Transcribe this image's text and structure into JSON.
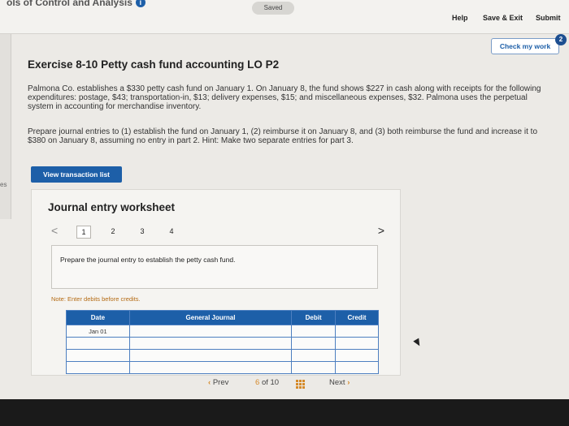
{
  "header": {
    "breadcrumb": "ols of Control and Analysis",
    "info_icon": "i",
    "status": "Saved",
    "help": "Help",
    "save_exit": "Save & Exit",
    "submit": "Submit",
    "check_work": "Check my work",
    "badge_count": "2"
  },
  "exercise": {
    "title": "Exercise 8-10 Petty cash fund accounting LO P2",
    "paragraph1": "Palmona Co. establishes a $330 petty cash fund on January 1. On January 8, the fund shows $227 in cash along with receipts for the following expenditures: postage, $43; transportation-in, $13; delivery expenses, $15; and miscellaneous expenses, $32. Palmona uses the perpetual system in accounting for merchandise inventory.",
    "paragraph2": "Prepare journal entries to (1) establish the fund on January 1, (2) reimburse it on January 8, and (3) both reimburse the fund and increase it to $380 on January 8, assuming no entry in part 2. Hint: Make two separate entries for part 3.",
    "view_transactions": "View transaction list",
    "edge_label": "es"
  },
  "worksheet": {
    "title": "Journal entry worksheet",
    "pages": [
      "1",
      "2",
      "3",
      "4"
    ],
    "active_page": "1",
    "prev_symbol": "<",
    "next_symbol": ">",
    "instruction": "Prepare the journal entry to establish the petty cash fund.",
    "note": "Note: Enter debits before credits.",
    "columns": [
      "Date",
      "General Journal",
      "Debit",
      "Credit"
    ],
    "rows": [
      {
        "date": "Jan 01",
        "account": "",
        "debit": "",
        "credit": ""
      },
      {
        "date": "",
        "account": "",
        "debit": "",
        "credit": ""
      },
      {
        "date": "",
        "account": "",
        "debit": "",
        "credit": ""
      },
      {
        "date": "",
        "account": "",
        "debit": "",
        "credit": ""
      }
    ]
  },
  "footer_nav": {
    "prev": "Prev",
    "current": "6",
    "of_label": "of",
    "total": "10",
    "next": "Next"
  },
  "colors": {
    "primary_blue": "#1d5fa8",
    "accent_orange": "#d58a2a",
    "note_orange": "#b46a12"
  }
}
